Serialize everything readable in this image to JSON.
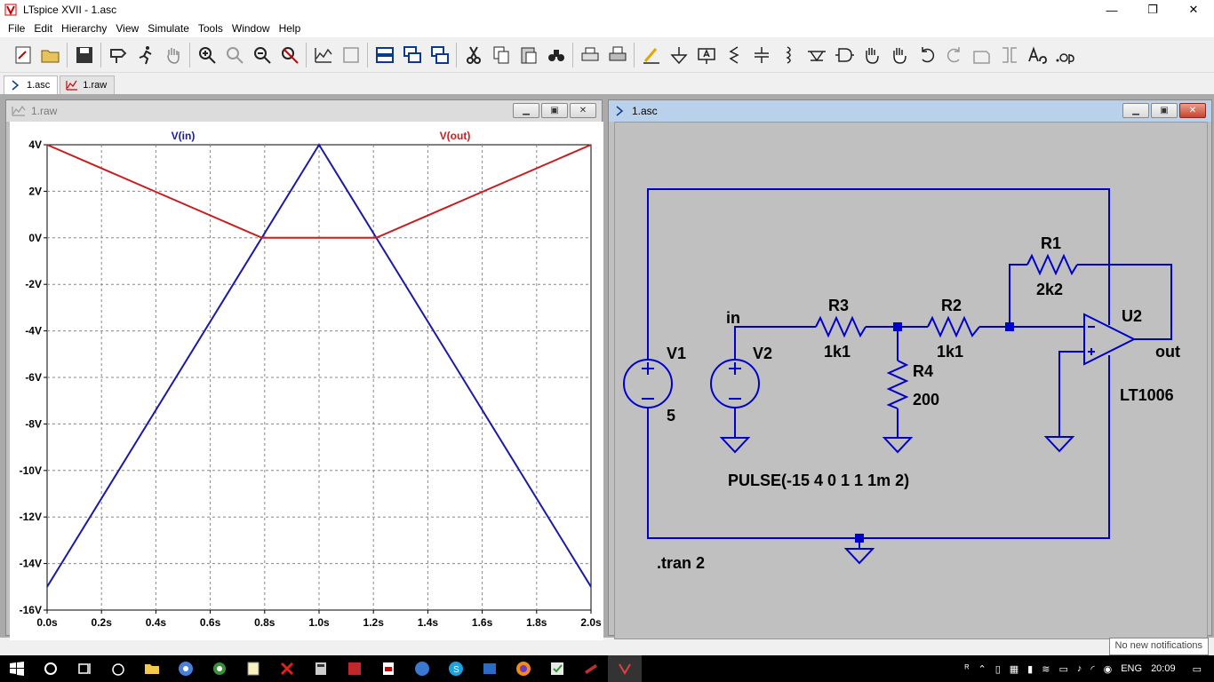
{
  "window": {
    "title": "LTspice XVII - 1.asc",
    "minimize": "—",
    "restore": "❐",
    "close": "✕"
  },
  "menu": [
    "File",
    "Edit",
    "Hierarchy",
    "View",
    "Simulate",
    "Tools",
    "Window",
    "Help"
  ],
  "toolbar_icons": [
    "new-schematic-icon",
    "open-icon",
    "save-icon",
    "control-panel-icon",
    "run-icon",
    "pan-icon",
    "zoom-in-icon",
    "zoom-full-icon",
    "zoom-out-icon",
    "zoom-cancel-icon",
    "autorange-icon",
    "fit-icon",
    "tile-horizontal-icon",
    "cascade-icon",
    "tile-vertical-icon",
    "cut-icon",
    "copy-icon",
    "paste-icon",
    "find-icon",
    "print-icon",
    "print-setup-icon",
    "draw-wire-icon",
    "ground-icon",
    "label-net-icon",
    "resistor-icon",
    "capacitor-icon",
    "inductor-icon",
    "diode-icon",
    "component-icon",
    "move-icon",
    "drag-icon",
    "undo-icon",
    "redo-icon",
    "rotate-icon",
    "mirror-icon",
    "text-icon",
    "spice-directive-icon"
  ],
  "tabs": [
    {
      "label": "1.asc",
      "icon": "schematic-icon"
    },
    {
      "label": "1.raw",
      "icon": "waveform-icon"
    }
  ],
  "waveform_window": {
    "title": "1.raw"
  },
  "schematic_window": {
    "title": "1.asc"
  },
  "chart_data": {
    "type": "line",
    "title": "",
    "xlabel": "",
    "ylabel": "",
    "x_ticks": [
      "0.0s",
      "0.2s",
      "0.4s",
      "0.6s",
      "0.8s",
      "1.0s",
      "1.2s",
      "1.4s",
      "1.6s",
      "1.8s",
      "2.0s"
    ],
    "y_ticks": [
      "4V",
      "2V",
      "0V",
      "-2V",
      "-4V",
      "-6V",
      "-8V",
      "-10V",
      "-12V",
      "-14V",
      "-16V"
    ],
    "xlim": [
      0,
      2.0
    ],
    "ylim": [
      -16,
      4
    ],
    "grid": true,
    "series": [
      {
        "name": "V(in)",
        "color": "#1a1aa6",
        "x": [
          0,
          1.0,
          2.0
        ],
        "y": [
          -15,
          4,
          -15
        ]
      },
      {
        "name": "V(out)",
        "color": "#c81e1e",
        "x": [
          0,
          0.79,
          1.21,
          2.0
        ],
        "y": [
          4,
          0,
          0,
          4
        ]
      }
    ]
  },
  "schematic": {
    "labels": {
      "V1": "V1",
      "V1_value": "5",
      "V2": "V2",
      "R3": "R3",
      "R3_value": "1k1",
      "R2": "R2",
      "R2_value": "1k1",
      "R1": "R1",
      "R1_value": "2k2",
      "R4": "R4",
      "R4_value": "200",
      "U2": "U2",
      "U2_value": "LT1006",
      "net_in": "in",
      "net_out": "out",
      "pulse": "PULSE(-15 4 0 1 1 1m 2)",
      "tran": ".tran 2",
      "plus": "+",
      "minus": "−"
    },
    "wire_color": "#0000cc"
  },
  "taskbar": {
    "icons": [
      "start-icon",
      "search-icon",
      "task-view-icon",
      "app-alarm-icon",
      "file-explorer-icon",
      "chrome-icon",
      "settings-icon",
      "notepad-icon",
      "x-app-icon",
      "calculator-icon",
      "app-red-icon",
      "app-pdf-icon",
      "app-blue-icon",
      "skype-icon",
      "app-outlook-icon",
      "firefox-icon",
      "app-green-icon",
      "app-stack-icon",
      "ltspice-icon"
    ],
    "tray_icons": [
      "people-icon",
      "chevron-up-icon",
      "usb-icon",
      "defender-icon",
      "notification-dot-icon",
      "wifi-icon",
      "battery-icon",
      "volume-icon",
      "connect-icon",
      "chrome-tray-icon"
    ],
    "language": "ENG",
    "time": "20:09",
    "notification": "No new notifications"
  }
}
